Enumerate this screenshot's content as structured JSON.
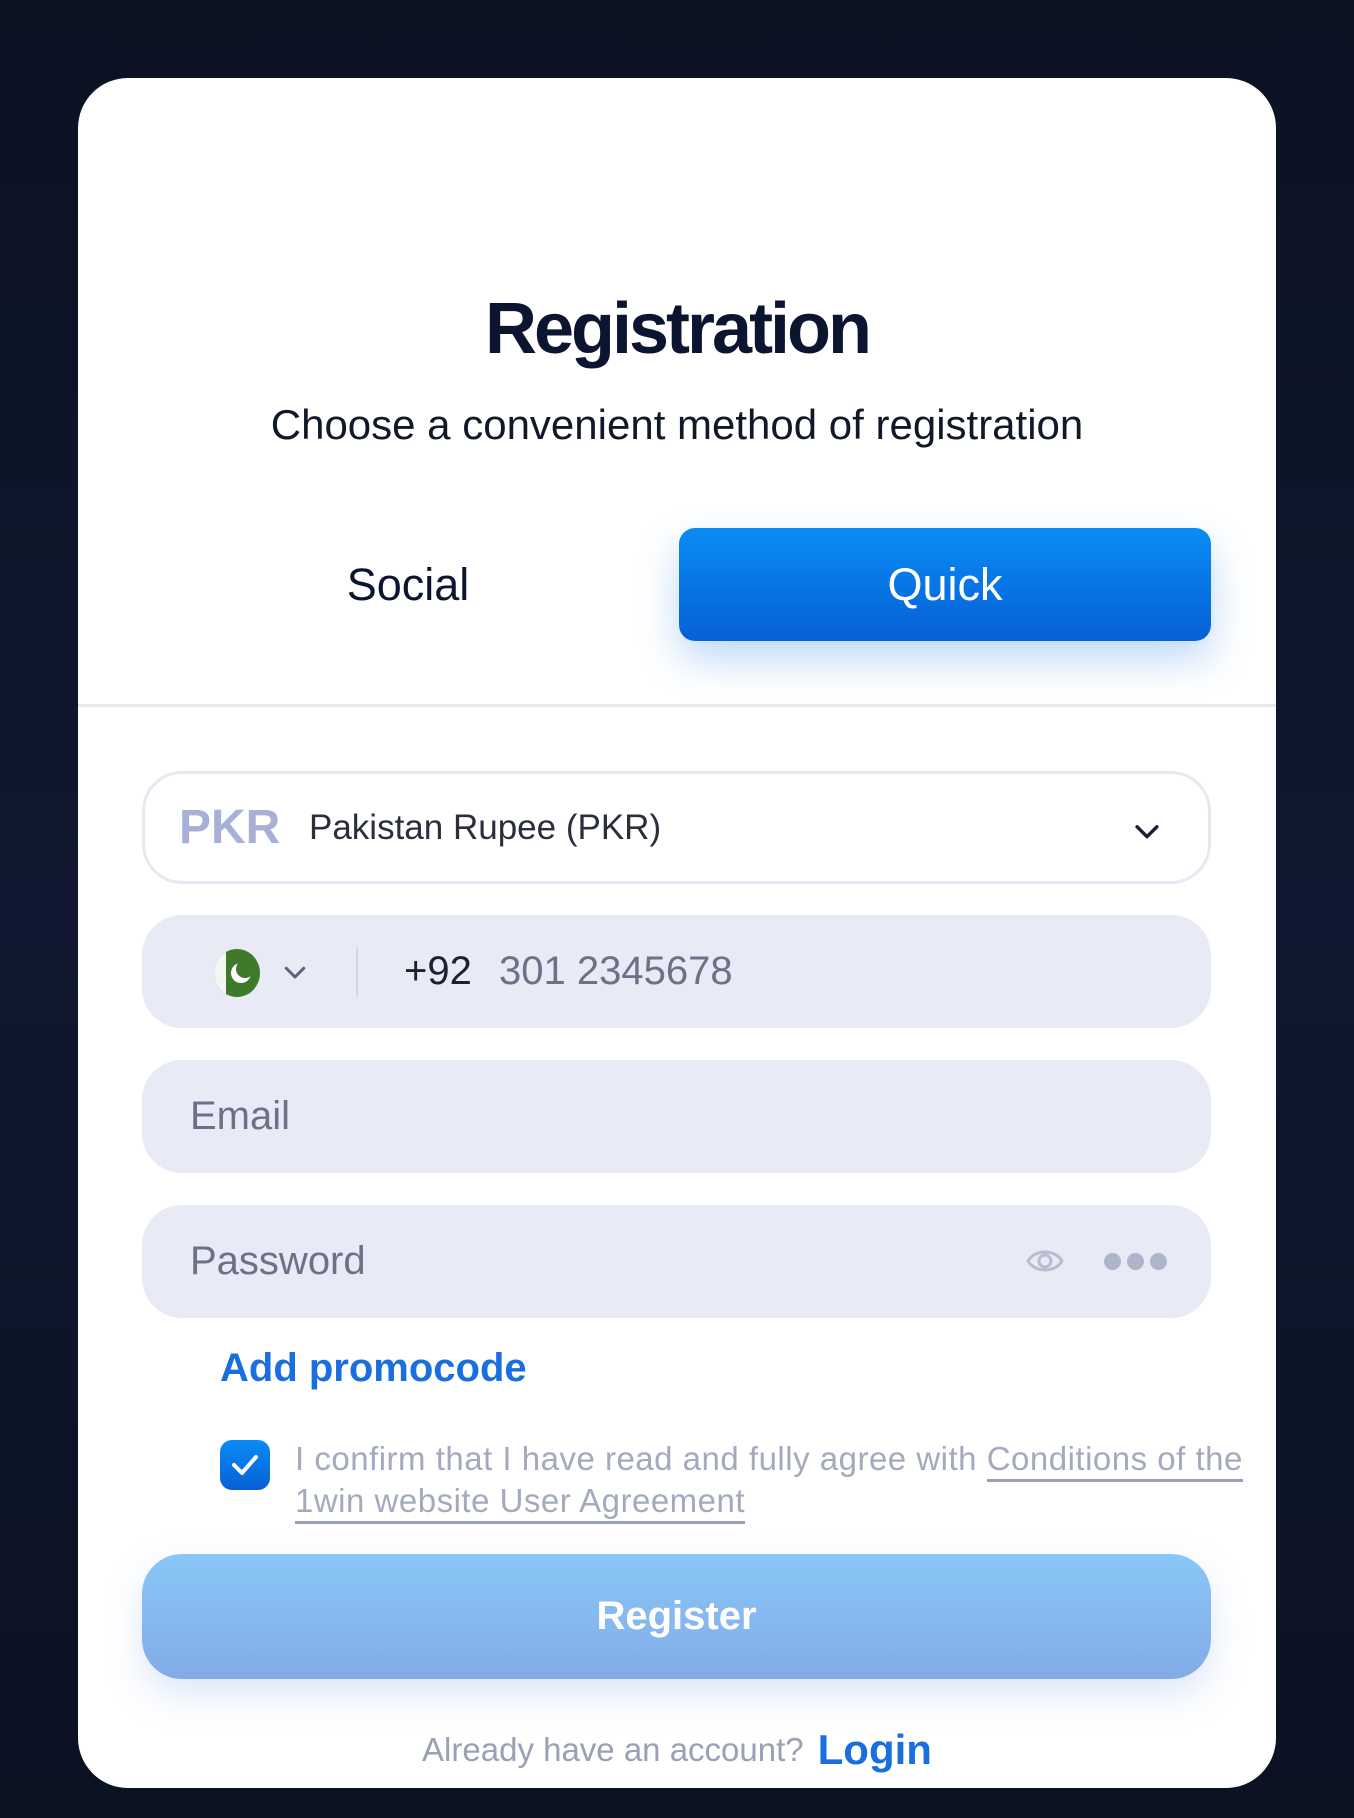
{
  "modal": {
    "title": "Registration",
    "subtitle": "Choose a convenient method of registration"
  },
  "tabs": [
    {
      "label": "Social",
      "active": false
    },
    {
      "label": "Quick",
      "active": true
    }
  ],
  "currency": {
    "code": "PKR",
    "name": "Pakistan Rupee (PKR)"
  },
  "phone": {
    "country_flag": "pakistan-flag-icon",
    "prefix": "+92",
    "placeholder": "301 2345678"
  },
  "email": {
    "placeholder": "Email"
  },
  "password": {
    "placeholder": "Password"
  },
  "promo": {
    "label": "Add promocode"
  },
  "agreement": {
    "checked": true,
    "text": "I confirm that I have read and fully agree with ",
    "link": "Conditions of the 1win website User Agreement"
  },
  "register": {
    "label": "Register"
  },
  "footer": {
    "question": "Already have an account?",
    "login_label": "Login"
  },
  "colors": {
    "accent": "#0a8cf5",
    "link": "#1a6fe0",
    "field_bg": "#e8ebf6",
    "backdrop": "#0d1426"
  }
}
